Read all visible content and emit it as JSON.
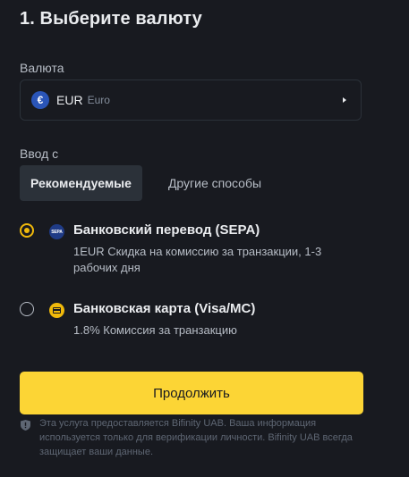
{
  "header": {
    "title": "1. Выберите валюту"
  },
  "currency": {
    "label": "Валюта",
    "icon_symbol": "€",
    "code": "EUR",
    "name": "Euro"
  },
  "payment": {
    "label": "Ввод с",
    "tabs": [
      {
        "label": "Рекомендуемые",
        "active": true
      },
      {
        "label": "Другие способы",
        "active": false
      }
    ],
    "options": [
      {
        "icon": "sepa-icon",
        "icon_text": "SEPA",
        "title": "Банковский перевод (SEPA)",
        "description": "1EUR Скидка на комиссию за транзакции, 1-3 рабочих дня",
        "selected": true
      },
      {
        "icon": "credit-card-icon",
        "title": "Банковская карта (Visa/MC)",
        "description": "1.8% Комиссия за транзакцию",
        "selected": false
      }
    ]
  },
  "actions": {
    "continue_label": "Продолжить"
  },
  "footer": {
    "icon": "shield-icon",
    "disclaimer": "Эта услуга предоставляется Bifinity UAB. Ваша информация используется только для верификации личности. Bifinity UAB всегда защищает ваши данные."
  },
  "colors": {
    "background": "#181a20",
    "accent": "#f0b90b",
    "button": "#fcd535",
    "text_primary": "#eaecef",
    "text_secondary": "#b7bdc6"
  }
}
